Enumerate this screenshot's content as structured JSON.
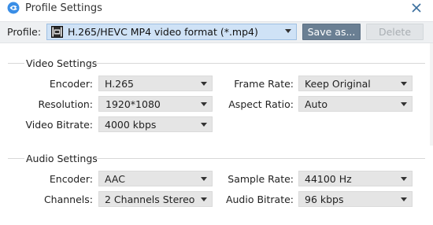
{
  "window": {
    "title": "Profile Settings",
    "app_icon": "app-logo-icon",
    "close_icon": "close-icon"
  },
  "profile": {
    "label": "Profile:",
    "value": "H.265/HEVC MP4 video format (*.mp4)",
    "format_icon": "mp4-icon",
    "save_as_label": "Save as...",
    "delete_label": "Delete"
  },
  "video": {
    "section_title": "Video Settings",
    "encoder_label": "Encoder:",
    "encoder_value": "H.265",
    "frame_rate_label": "Frame Rate:",
    "frame_rate_value": "Keep Original",
    "resolution_label": "Resolution:",
    "resolution_value": "1920*1080",
    "aspect_ratio_label": "Aspect Ratio:",
    "aspect_ratio_value": "Auto",
    "bitrate_label": "Video Bitrate:",
    "bitrate_value": "4000 kbps"
  },
  "audio": {
    "section_title": "Audio Settings",
    "encoder_label": "Encoder:",
    "encoder_value": "AAC",
    "sample_rate_label": "Sample Rate:",
    "sample_rate_value": "44100 Hz",
    "channels_label": "Channels:",
    "channels_value": "2 Channels Stereo",
    "bitrate_label": "Audio Bitrate:",
    "bitrate_value": "96 kbps"
  },
  "colors": {
    "save_button": "#6a7f93",
    "profile_highlight": "#cfe2f6",
    "dropdown_bg": "#e5e5e5"
  }
}
